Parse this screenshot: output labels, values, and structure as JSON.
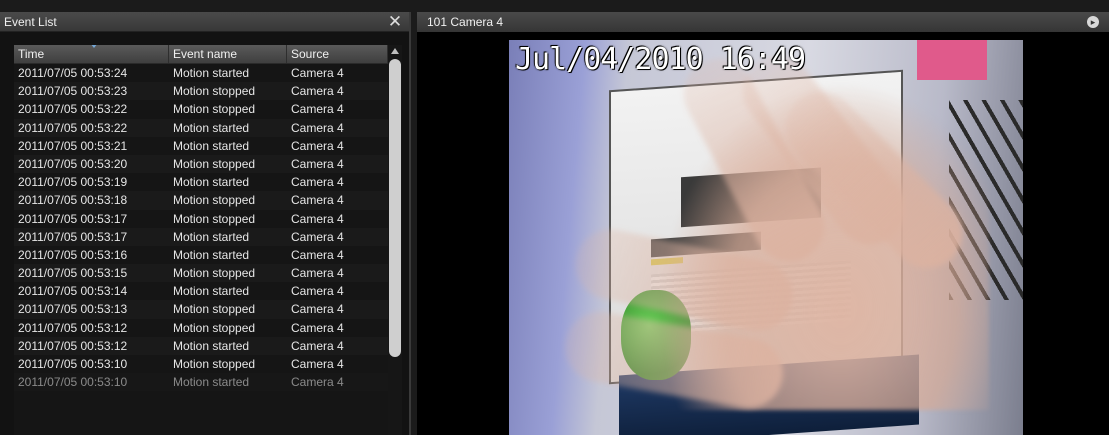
{
  "event_panel": {
    "title": "Event List",
    "close_glyph": "✕",
    "columns": [
      "Time",
      "Event name",
      "Source"
    ],
    "rows": [
      {
        "time": "2011/07/05  00:53:24",
        "event": "Motion started",
        "source": "Camera 4"
      },
      {
        "time": "2011/07/05  00:53:23",
        "event": "Motion stopped",
        "source": "Camera 4"
      },
      {
        "time": "2011/07/05  00:53:22",
        "event": "Motion stopped",
        "source": "Camera 4"
      },
      {
        "time": "2011/07/05  00:53:22",
        "event": "Motion started",
        "source": "Camera 4"
      },
      {
        "time": "2011/07/05  00:53:21",
        "event": "Motion started",
        "source": "Camera 4"
      },
      {
        "time": "2011/07/05  00:53:20",
        "event": "Motion stopped",
        "source": "Camera 4"
      },
      {
        "time": "2011/07/05  00:53:19",
        "event": "Motion started",
        "source": "Camera 4"
      },
      {
        "time": "2011/07/05  00:53:18",
        "event": "Motion stopped",
        "source": "Camera 4"
      },
      {
        "time": "2011/07/05  00:53:17",
        "event": "Motion stopped",
        "source": "Camera 4"
      },
      {
        "time": "2011/07/05  00:53:17",
        "event": "Motion started",
        "source": "Camera 4"
      },
      {
        "time": "2011/07/05  00:53:16",
        "event": "Motion started",
        "source": "Camera 4"
      },
      {
        "time": "2011/07/05  00:53:15",
        "event": "Motion stopped",
        "source": "Camera 4"
      },
      {
        "time": "2011/07/05  00:53:14",
        "event": "Motion started",
        "source": "Camera 4"
      },
      {
        "time": "2011/07/05  00:53:13",
        "event": "Motion stopped",
        "source": "Camera 4"
      },
      {
        "time": "2011/07/05  00:53:12",
        "event": "Motion stopped",
        "source": "Camera 4"
      },
      {
        "time": "2011/07/05  00:53:12",
        "event": "Motion started",
        "source": "Camera 4"
      },
      {
        "time": "2011/07/05  00:53:10",
        "event": "Motion stopped",
        "source": "Camera 4"
      },
      {
        "time": "2011/07/05  00:53:10",
        "event": "Motion started",
        "source": "Camera 4"
      }
    ]
  },
  "camera_panel": {
    "title": "101  Camera 4",
    "menu_glyph": "▸",
    "osd_timestamp": "Jul/04/2010 16:49"
  }
}
